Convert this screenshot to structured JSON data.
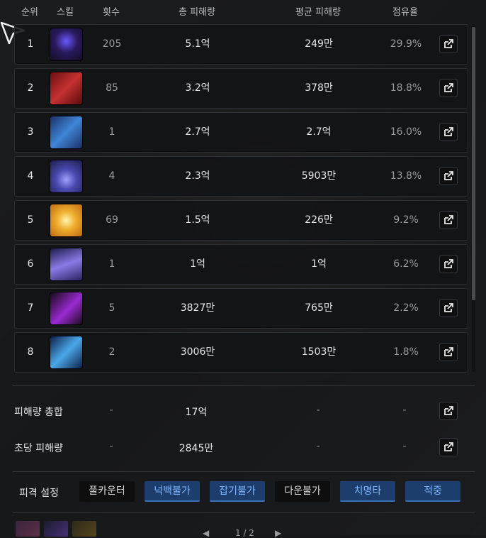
{
  "header": {
    "rank": "순위",
    "skill": "스킬",
    "hits": "횟수",
    "total": "총 피해량",
    "avg": "평균 피해량",
    "share": "점유율"
  },
  "rows": [
    {
      "rank": "1",
      "hits": "205",
      "total": "5.1억",
      "avg": "249만",
      "share": "29.9%",
      "icon": "dark-figure-skill-icon"
    },
    {
      "rank": "2",
      "hits": "85",
      "total": "3.2억",
      "avg": "378만",
      "share": "18.8%",
      "icon": "crossed-blades-skill-icon"
    },
    {
      "rank": "3",
      "hits": "1",
      "total": "2.7억",
      "avg": "2.7억",
      "share": "16.0%",
      "icon": "blue-slash-skill-icon"
    },
    {
      "rank": "4",
      "hits": "4",
      "total": "2.3억",
      "avg": "5903만",
      "share": "13.8%",
      "icon": "summoner-skill-icon"
    },
    {
      "rank": "5",
      "hits": "69",
      "total": "1.5억",
      "avg": "226만",
      "share": "9.2%",
      "icon": "golden-burst-skill-icon"
    },
    {
      "rank": "6",
      "hits": "1",
      "total": "1억",
      "avg": "1억",
      "share": "6.2%",
      "icon": "violet-swirl-skill-icon"
    },
    {
      "rank": "7",
      "hits": "5",
      "total": "3827만",
      "avg": "765만",
      "share": "2.2%",
      "icon": "pink-strike-skill-icon"
    },
    {
      "rank": "8",
      "hits": "2",
      "total": "3006만",
      "avg": "1503만",
      "share": "1.8%",
      "icon": "ice-dash-skill-icon"
    }
  ],
  "summary": [
    {
      "label": "피해량 총합",
      "hits": "-",
      "total": "17억",
      "avg": "-",
      "share": "-"
    },
    {
      "label": "초당 피해량",
      "hits": "-",
      "total": "2845만",
      "avg": "-",
      "share": "-"
    }
  ],
  "settings": {
    "label": "피격 설정",
    "chips": [
      {
        "label": "풀카운터",
        "active": false
      },
      {
        "label": "넉백불가",
        "active": true
      },
      {
        "label": "잡기불가",
        "active": true
      },
      {
        "label": "다운불가",
        "active": false
      },
      {
        "label": "치명타",
        "active": true
      },
      {
        "label": "적중",
        "active": true
      }
    ]
  },
  "pager": {
    "text": "1 / 2"
  },
  "colors": {
    "active_chip_bg": "#1d3e6c",
    "active_chip_text": "#7fb7ff",
    "inactive_chip_bg": "#0e0e0f"
  },
  "icons": {
    "share": "external-share-icon",
    "cursor": "mouse-pointer-icon"
  }
}
